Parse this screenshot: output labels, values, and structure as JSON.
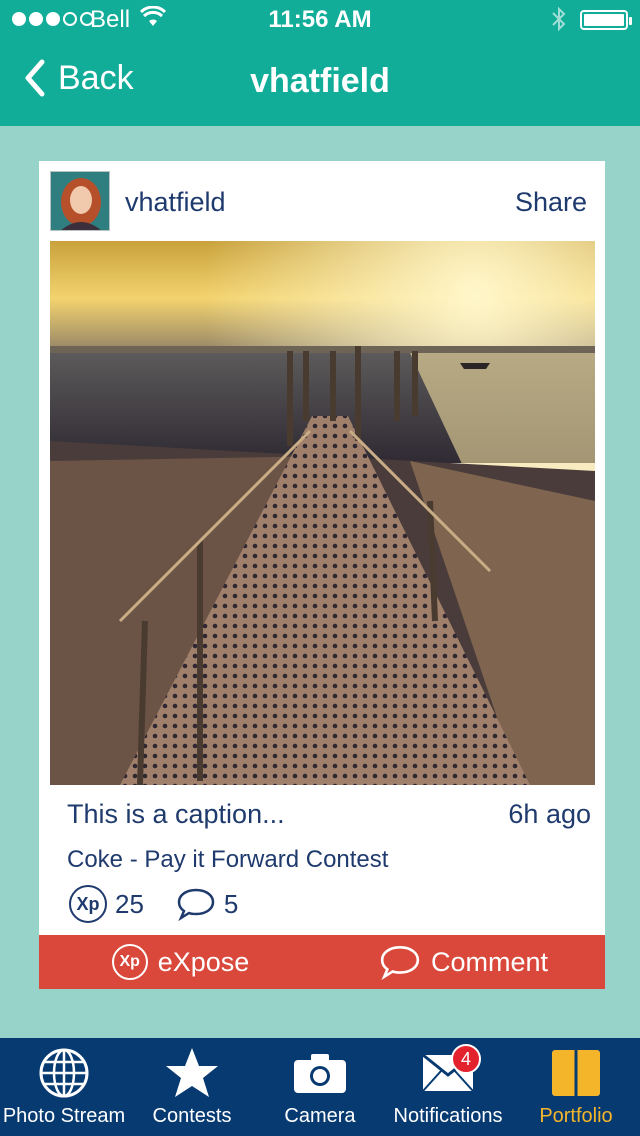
{
  "status_bar": {
    "carrier": "Bell",
    "time": "11:56 AM"
  },
  "nav": {
    "back_label": "Back",
    "title": "vhatfield"
  },
  "post": {
    "username": "vhatfield",
    "share_label": "Share",
    "caption": "This is a caption...",
    "time_ago": "6h ago",
    "contest": "Coke - Pay it Forward Contest",
    "xp_count": "25",
    "comment_count": "5",
    "xp_badge_text": "Xp"
  },
  "actions": {
    "expose_label": "eXpose",
    "comment_label": "Comment"
  },
  "tabs": [
    {
      "label": "Photo Stream",
      "icon": "globe-icon"
    },
    {
      "label": "Contests",
      "icon": "star-icon"
    },
    {
      "label": "Camera",
      "icon": "camera-icon"
    },
    {
      "label": "Notifications",
      "icon": "mail-icon",
      "badge": "4"
    },
    {
      "label": "Portfolio",
      "icon": "book-icon",
      "active": true
    }
  ],
  "colors": {
    "header": "#12ad99",
    "background": "#98d3c9",
    "action_bar": "#d9483b",
    "tab_bar": "#073a71",
    "active_tab": "#f4b52b",
    "text": "#1f3a6d"
  }
}
